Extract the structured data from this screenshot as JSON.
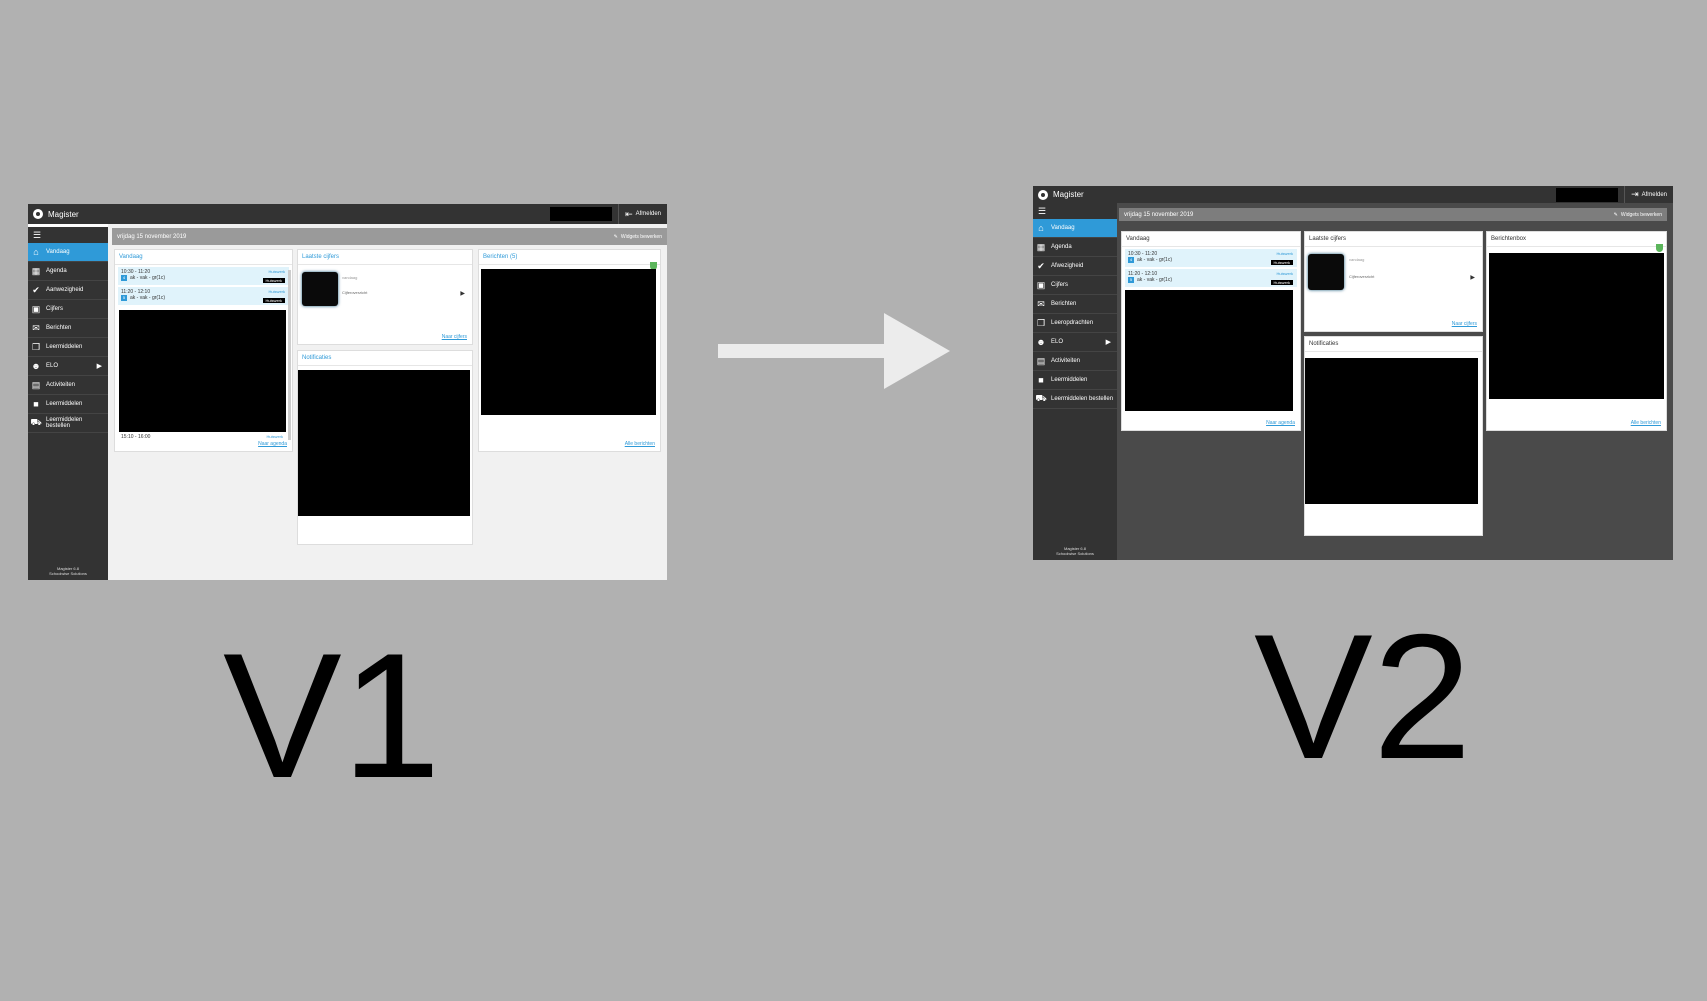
{
  "labels": {
    "v1": "V1",
    "v2": "V2"
  },
  "v1": {
    "app_title": "Magister",
    "logout_label": "Afmelden",
    "date": "vrijdag 15 november 2019",
    "edit_label": "Widgets bewerken",
    "nav": [
      {
        "label": "Vandaag",
        "icon": "home-icon",
        "active": true
      },
      {
        "label": "Agenda",
        "icon": "calendar-icon"
      },
      {
        "label": "Aanwezigheid",
        "icon": "check-circle-icon"
      },
      {
        "label": "Cijfers",
        "icon": "grades-icon"
      },
      {
        "label": "Berichten",
        "icon": "mail-icon"
      },
      {
        "label": "Leermiddelen",
        "icon": "books-icon"
      },
      {
        "label": "ELO",
        "icon": "group-icon",
        "submenu": true
      },
      {
        "label": "Activiteiten",
        "icon": "activity-icon"
      },
      {
        "label": "Leermiddelen",
        "icon": "box-icon"
      },
      {
        "label": "Leermiddelen bestellen",
        "icon": "cart-icon"
      }
    ],
    "footer_line1": "Magister 6.8",
    "footer_line2": "Schoolwise Solutions",
    "vandaag": {
      "title": "Vandaag",
      "appts": [
        {
          "time": "10:30 - 11:20",
          "num": "4",
          "course": "ak - vak - gr(1c)",
          "badge": "Huiswerk",
          "chip": "Huiswerk"
        },
        {
          "time": "11:20 - 12:10",
          "num": "5",
          "course": "ak - vak - gr(1c)",
          "badge": "Huiswerk",
          "chip": "Huiswerk"
        }
      ],
      "last_time": "15:10 - 16:00",
      "last_badge": "Huiswerk",
      "link": "Naar agenda"
    },
    "cijfers": {
      "title": "Laatste cijfers",
      "subtitle": "vandaag",
      "desc": "Cijferoverzicht",
      "link": "Naar cijfers"
    },
    "notificaties": {
      "title": "Notificaties"
    },
    "berichten": {
      "title": "Berichten (5)",
      "link": "Alle berichten"
    }
  },
  "v2": {
    "app_title": "Magister",
    "logout_label": "Afmelden",
    "date": "vrijdag 15 november 2019",
    "edit_label": "Widgets bewerken",
    "nav": [
      {
        "label": "Vandaag",
        "icon": "home-icon",
        "active": true
      },
      {
        "label": "Agenda",
        "icon": "calendar-icon"
      },
      {
        "label": "Afwezigheid",
        "icon": "check-circle-icon"
      },
      {
        "label": "Cijfers",
        "icon": "grades-icon"
      },
      {
        "label": "Berichten",
        "icon": "mail-icon"
      },
      {
        "label": "Leeropdrachten",
        "icon": "books-icon"
      },
      {
        "label": "ELO",
        "icon": "group-icon",
        "submenu": true
      },
      {
        "label": "Activiteiten",
        "icon": "activity-icon"
      },
      {
        "label": "Leermiddelen",
        "icon": "box-icon"
      },
      {
        "label": "Leermiddelen bestellen",
        "icon": "cart-icon"
      }
    ],
    "footer_line1": "Magister 6.8",
    "footer_line2": "Schoolwise Solutions",
    "vandaag": {
      "title": "Vandaag",
      "appts": [
        {
          "time": "10:30 - 11:20",
          "num": "4",
          "course": "ak - vak - gr(1c)",
          "badge": "Huiswerk",
          "chip": "Huiswerk"
        },
        {
          "time": "11:20 - 12:10",
          "num": "5",
          "course": "ak - vak - gr(1c)",
          "badge": "Huiswerk",
          "chip": "Huiswerk"
        }
      ],
      "link": "Naar agenda"
    },
    "cijfers": {
      "title": "Laatste cijfers",
      "subtitle": "vandaag",
      "desc": "Cijferoverzicht",
      "link": "Naar cijfers"
    },
    "notificaties": {
      "title": "Notificaties"
    },
    "berichten": {
      "title": "Berichtenbox",
      "link": "Alle berichten"
    }
  }
}
